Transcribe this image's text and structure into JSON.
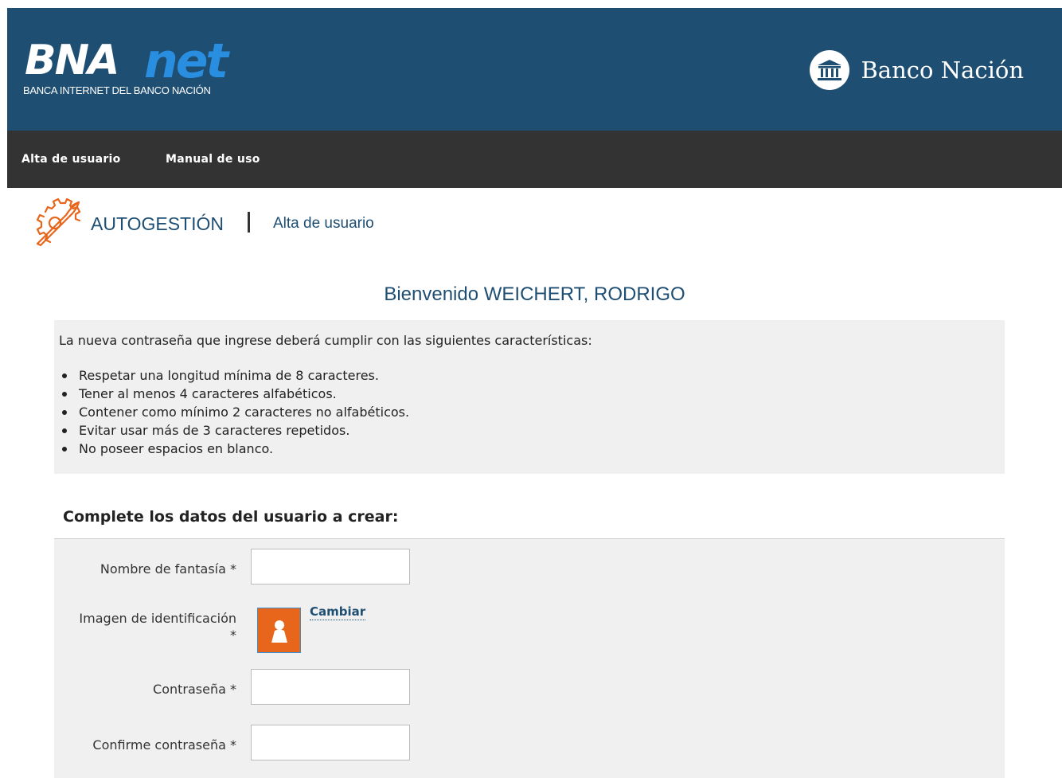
{
  "brand": {
    "bna_part": "BNA",
    "net_part": "net",
    "subtitle": "BANCA INTERNET DEL BANCO NACIÓN",
    "bank_name": "Banco Nación",
    "bank_icon": "bank-building-icon"
  },
  "colors": {
    "header_bg": "#1f4e73",
    "nav_bg": "#333333",
    "accent_blue": "#2a8ee0",
    "panel_bg": "#f0f0f0",
    "icon_orange": "#e8661b"
  },
  "nav": {
    "items": [
      {
        "label": "Alta de usuario"
      },
      {
        "label": "Manual de uso"
      }
    ]
  },
  "breadcrumb": {
    "icon": "gear-wrench-icon",
    "section": "AUTOGESTIÓN",
    "page": "Alta de usuario"
  },
  "welcome": "Bienvenido WEICHERT, RODRIGO",
  "rules": {
    "intro": "La nueva contraseña que ingrese deberá cumplir con las siguientes características:",
    "items": [
      "Respetar una longitud mínima de 8 caracteres.",
      "Tener al menos 4 caracteres alfabéticos.",
      "Contener como mínimo 2 caracteres no alfabéticos.",
      "Evitar usar más de 3 caracteres repetidos.",
      "No poseer espacios en blanco."
    ]
  },
  "form": {
    "title": "Complete los datos del usuario a crear:",
    "fantasy_name_label": "Nombre de fantasía *",
    "fantasy_name_value": "",
    "image_label_line1": "Imagen de identificación",
    "image_label_line2": "*",
    "image_icon": "user-silhouette-icon",
    "change_link": "Cambiar",
    "password_label": "Contraseña *",
    "password_value": "",
    "confirm_label": "Confirme contraseña *",
    "confirm_value": ""
  }
}
